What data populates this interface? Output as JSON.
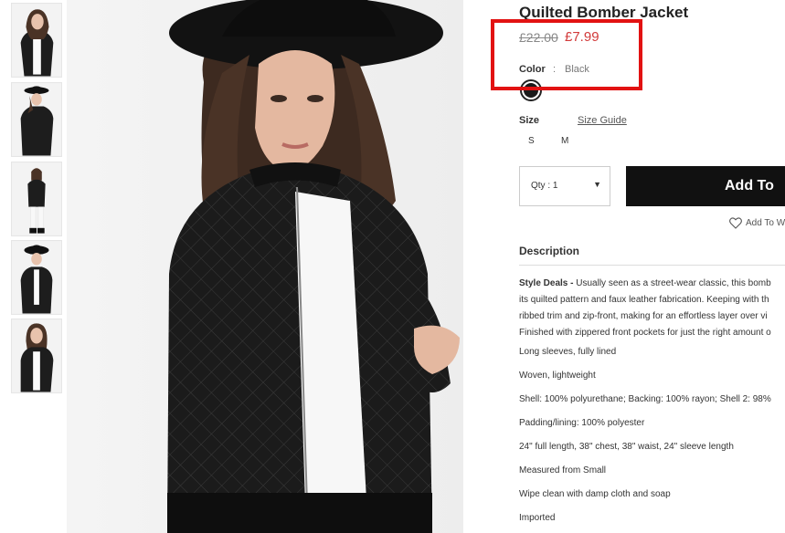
{
  "product": {
    "title": "Quilted Bomber Jacket",
    "price_old": "£22.00",
    "price_new": "£7.99",
    "color_label": "Color",
    "color_sep": ":",
    "color_value": "Black",
    "size_label": "Size",
    "size_guide": "Size Guide",
    "sizes": [
      "S",
      "M"
    ],
    "qty_label": "Qty : 1",
    "qty_caret": "▼",
    "add_button": "Add To",
    "wishlist": "Add To W"
  },
  "description": {
    "heading": "Description",
    "intro_bold": "Style Deals -",
    "intro_lines": [
      " Usually seen as a street-wear classic, this bomb",
      "its quilted pattern and faux leather fabrication. Keeping with th",
      "ribbed trim and zip-front, making for an effortless layer over vi",
      "Finished with zippered front pockets for just the right amount o"
    ],
    "bullets": [
      "Long sleeves, fully lined",
      "Woven, lightweight",
      "Shell: 100% polyurethane; Backing: 100% rayon; Shell 2: 98%",
      "Padding/lining: 100% polyester",
      "24\" full length, 38\" chest, 38\" waist, 24\" sleeve length",
      "Measured from Small",
      "Wipe clean with damp cloth and soap",
      "Imported"
    ]
  },
  "colors": {
    "price_sale": "#d23a3a",
    "highlight": "#e21212",
    "button_bg": "#111111"
  }
}
